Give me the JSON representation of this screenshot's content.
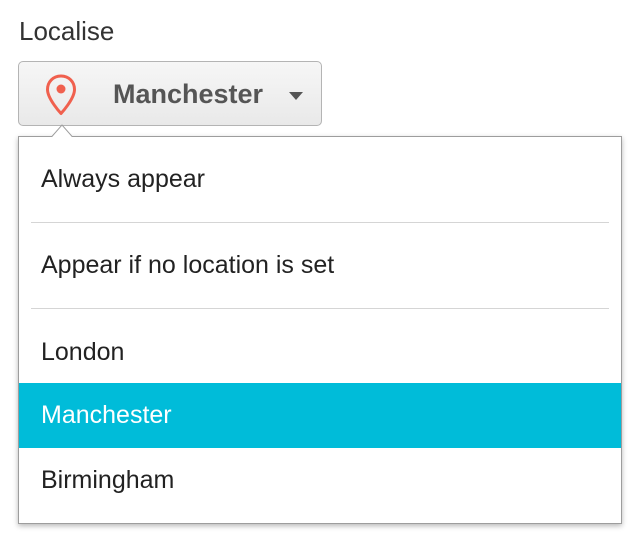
{
  "field_label": "Localise",
  "trigger": {
    "icon": "map-pin-icon",
    "selected_label": "Manchester",
    "caret_icon": "caret-down-icon"
  },
  "menu": {
    "items": [
      {
        "label": "Always appear"
      },
      {
        "label": "Appear if no location is set"
      },
      {
        "label": "London"
      },
      {
        "label": "Manchester",
        "selected": true
      },
      {
        "label": "Birmingham"
      }
    ]
  },
  "colors": {
    "highlight": "#00bcd9",
    "pin": "#f0604e",
    "text": "#222222",
    "muted_text": "#555555"
  }
}
